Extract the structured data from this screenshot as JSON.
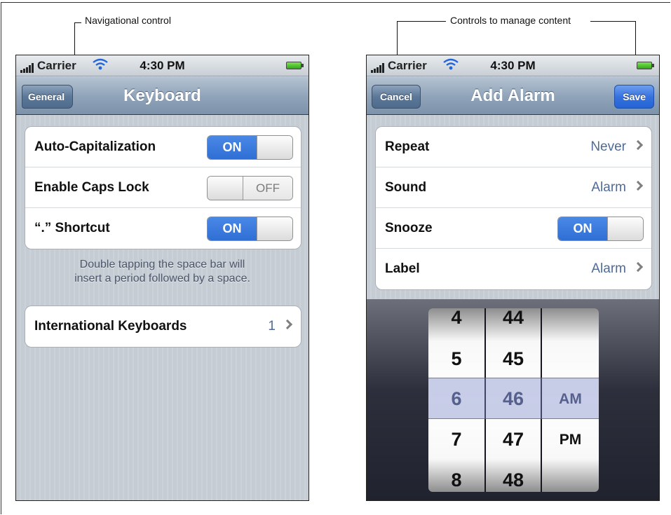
{
  "annotations": {
    "nav_label": "Navigational control",
    "content_label": "Controls to manage content"
  },
  "status": {
    "carrier": "Carrier",
    "time": "4:30 PM"
  },
  "keyboard_screen": {
    "back_button": "General",
    "title": "Keyboard",
    "rows": [
      {
        "label": "Auto-Capitalization",
        "toggle": "ON"
      },
      {
        "label": "Enable Caps Lock",
        "toggle": "OFF"
      },
      {
        "label": "“.” Shortcut",
        "toggle": "ON"
      }
    ],
    "footnote_line1": "Double tapping the space bar will",
    "footnote_line2": "insert a period followed by a space.",
    "intl_row": {
      "label": "International Keyboards",
      "value": "1"
    }
  },
  "alarm_screen": {
    "cancel_button": "Cancel",
    "title": "Add Alarm",
    "save_button": "Save",
    "rows": [
      {
        "label": "Repeat",
        "value": "Never"
      },
      {
        "label": "Sound",
        "value": "Alarm"
      },
      {
        "label": "Snooze",
        "toggle": "ON"
      },
      {
        "label": "Label",
        "value": "Alarm"
      }
    ],
    "picker": {
      "hours": [
        "4",
        "5",
        "6",
        "7",
        "8"
      ],
      "minutes": [
        "44",
        "45",
        "46",
        "47",
        "48"
      ],
      "periods": [
        "AM",
        "PM"
      ],
      "selected": {
        "hour": "6",
        "minute": "46",
        "period": "AM"
      }
    }
  }
}
